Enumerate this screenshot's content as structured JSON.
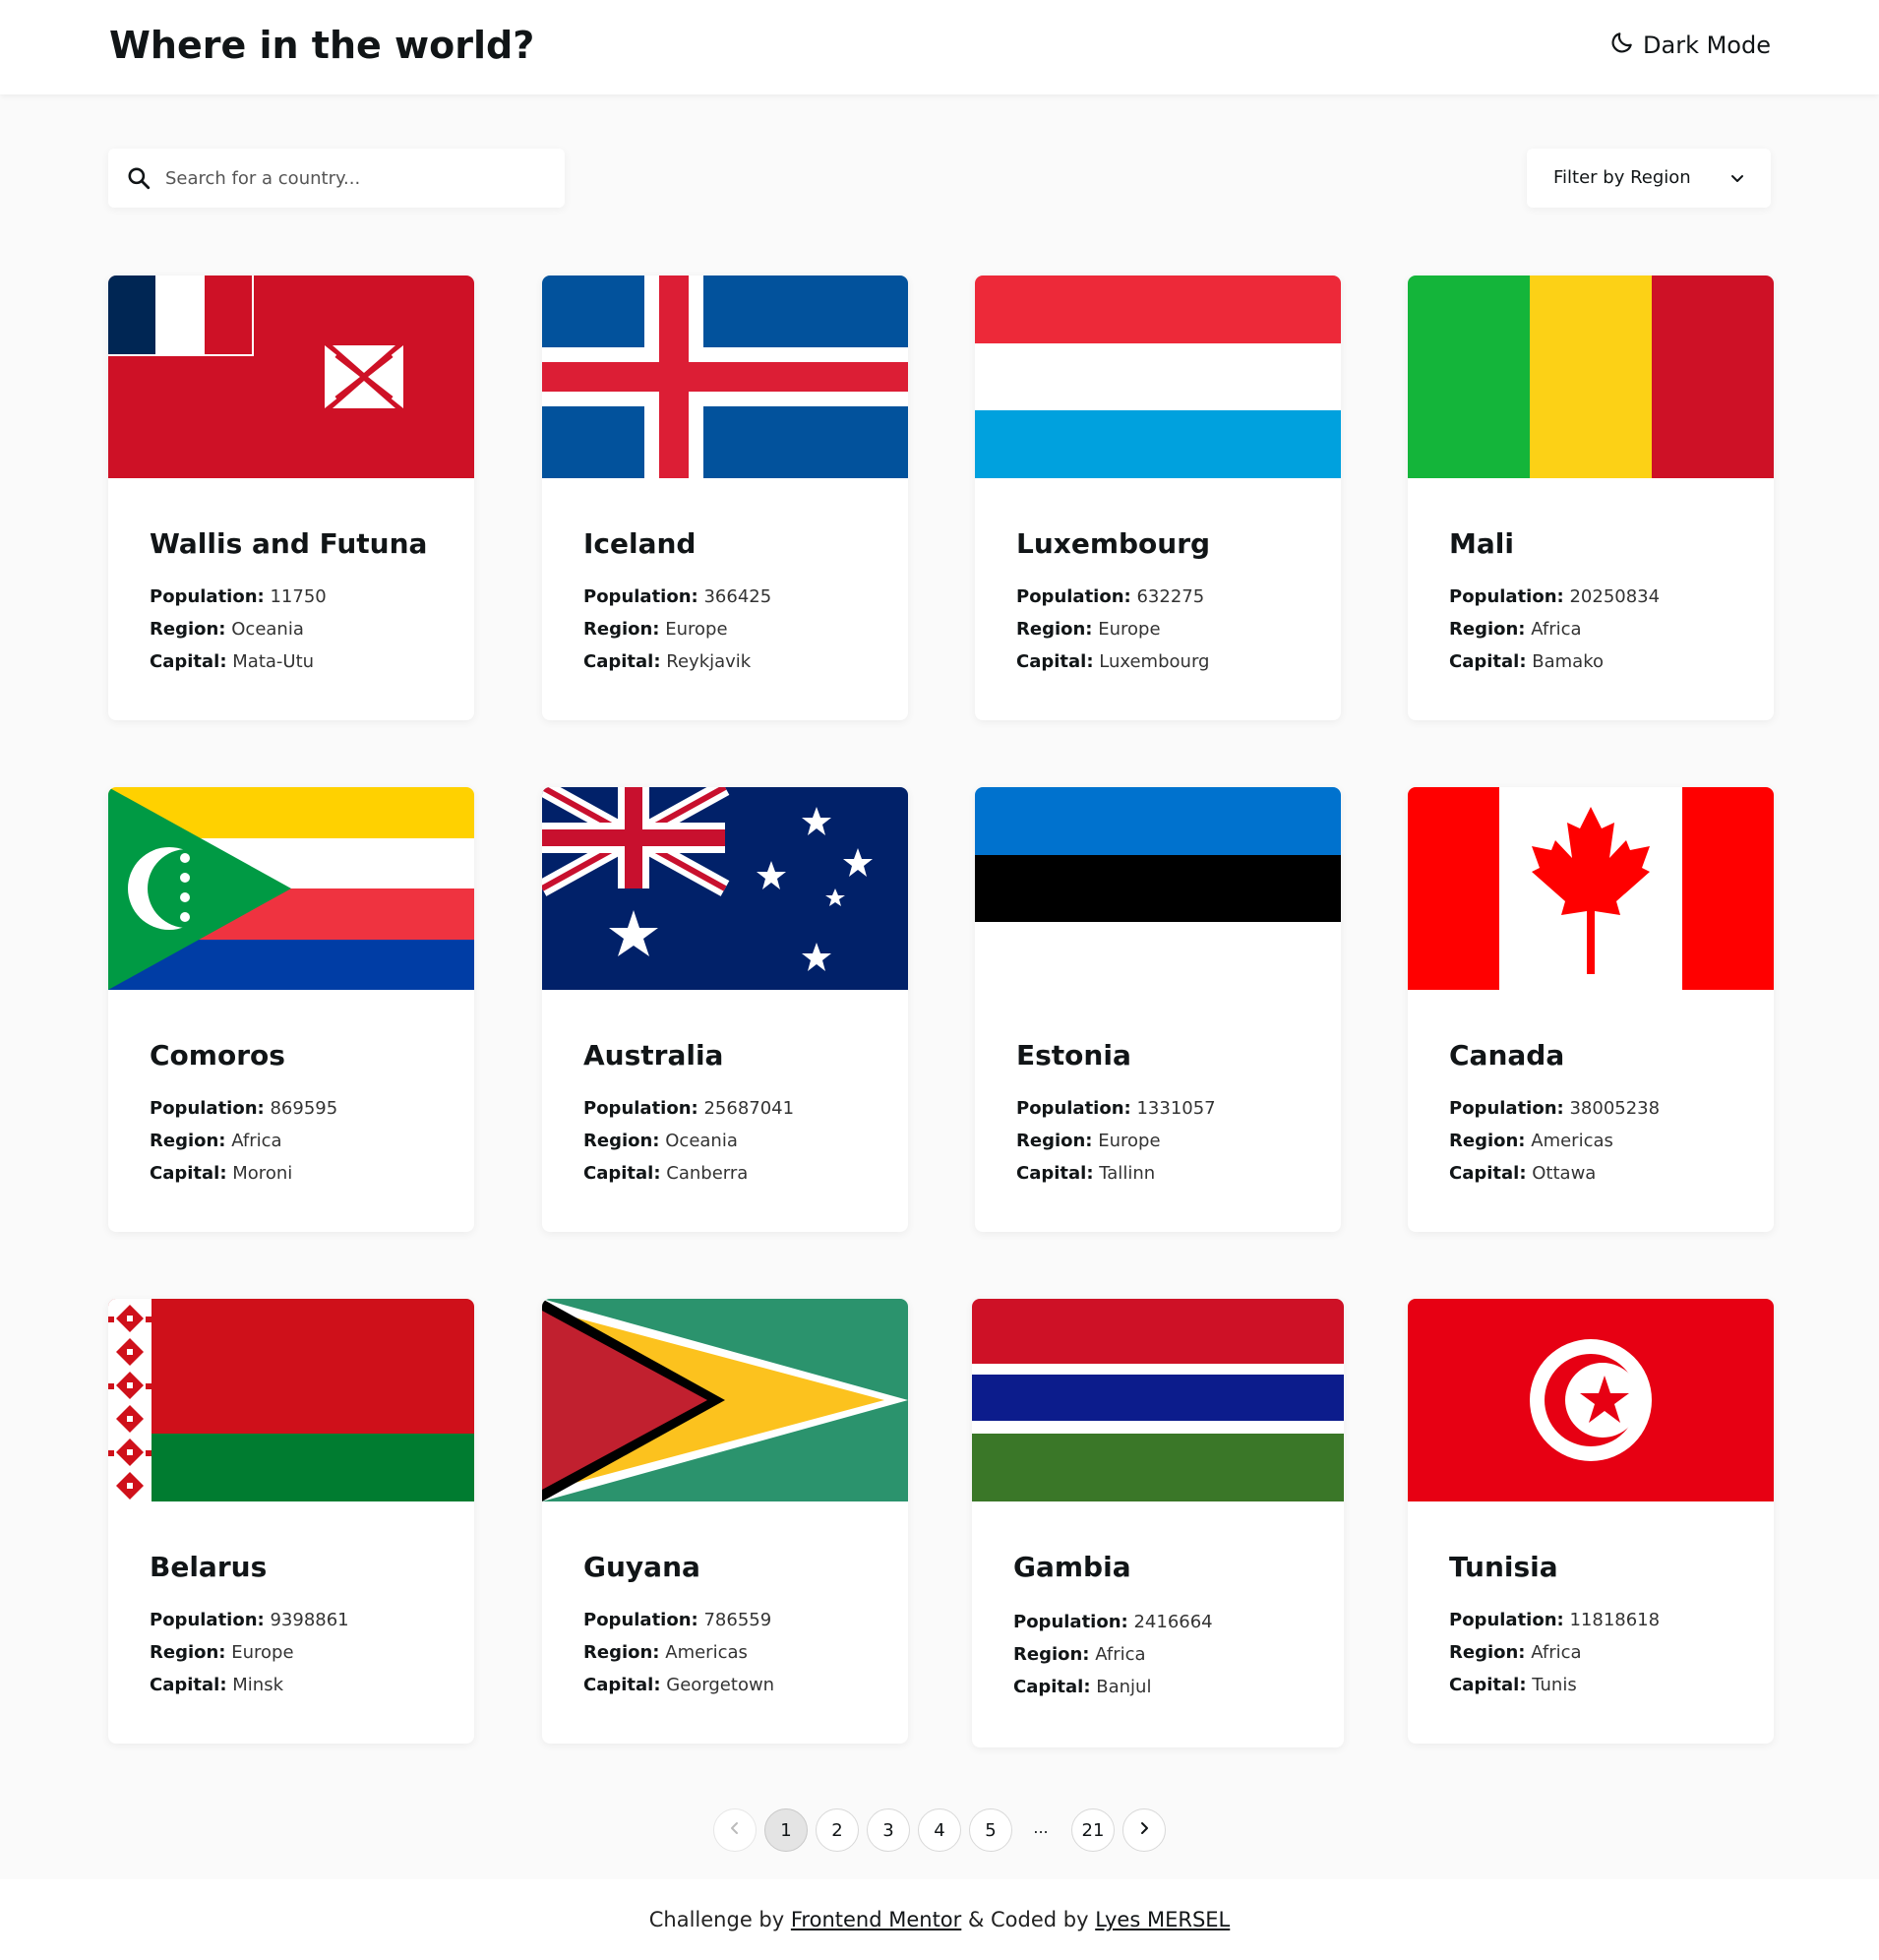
{
  "header": {
    "title": "Where in the world?",
    "theme_toggle_label": "Dark Mode",
    "theme_toggle_icon": "moon-icon"
  },
  "search": {
    "placeholder": "Search for a country...",
    "value": "",
    "icon": "search-icon"
  },
  "filter": {
    "label": "Filter by Region",
    "icon": "chevron-down-icon"
  },
  "labels": {
    "population": "Population:",
    "region": "Region:",
    "capital": "Capital:"
  },
  "countries": [
    {
      "name": "Wallis and Futuna",
      "population": "11750",
      "region": "Oceania",
      "capital": "Mata-Utu",
      "flag": "wallis-futuna-flag"
    },
    {
      "name": "Iceland",
      "population": "366425",
      "region": "Europe",
      "capital": "Reykjavik",
      "flag": "iceland-flag"
    },
    {
      "name": "Luxembourg",
      "population": "632275",
      "region": "Europe",
      "capital": "Luxembourg",
      "flag": "luxembourg-flag"
    },
    {
      "name": "Mali",
      "population": "20250834",
      "region": "Africa",
      "capital": "Bamako",
      "flag": "mali-flag"
    },
    {
      "name": "Comoros",
      "population": "869595",
      "region": "Africa",
      "capital": "Moroni",
      "flag": "comoros-flag"
    },
    {
      "name": "Australia",
      "population": "25687041",
      "region": "Oceania",
      "capital": "Canberra",
      "flag": "australia-flag"
    },
    {
      "name": "Estonia",
      "population": "1331057",
      "region": "Europe",
      "capital": "Tallinn",
      "flag": "estonia-flag"
    },
    {
      "name": "Canada",
      "population": "38005238",
      "region": "Americas",
      "capital": "Ottawa",
      "flag": "canada-flag"
    },
    {
      "name": "Belarus",
      "population": "9398861",
      "region": "Europe",
      "capital": "Minsk",
      "flag": "belarus-flag"
    },
    {
      "name": "Guyana",
      "population": "786559",
      "region": "Americas",
      "capital": "Georgetown",
      "flag": "guyana-flag"
    },
    {
      "name": "Gambia",
      "population": "2416664",
      "region": "Africa",
      "capital": "Banjul",
      "flag": "gambia-flag"
    },
    {
      "name": "Tunisia",
      "population": "11818618",
      "region": "Africa",
      "capital": "Tunis",
      "flag": "tunisia-flag"
    }
  ],
  "pagination": {
    "current": "1",
    "pages": [
      "1",
      "2",
      "3",
      "4",
      "5"
    ],
    "ellipsis": "...",
    "last": "21"
  },
  "footer": {
    "prefix": "Challenge by ",
    "link1": "Frontend Mentor",
    "middle": " & Coded by ",
    "link2": "Lyes MERSEL"
  },
  "colors": {
    "background": "#fafafa",
    "surface": "#ffffff",
    "text": "#111517"
  }
}
